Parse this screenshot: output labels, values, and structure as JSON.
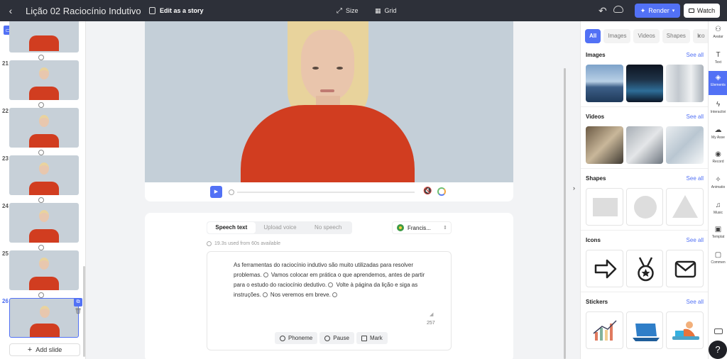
{
  "topbar": {
    "back": "‹",
    "title": "Lição 02 Raciocínio Indutivo",
    "edit_story": "Edit as a story",
    "size": "Size",
    "grid": "Grid",
    "render": "Render",
    "watch": "Watch"
  },
  "slides": {
    "items": [
      {
        "num": ""
      },
      {
        "num": "21"
      },
      {
        "num": "22"
      },
      {
        "num": "23"
      },
      {
        "num": "24"
      },
      {
        "num": "25"
      },
      {
        "num": "26"
      }
    ],
    "add_slide": "Add slide"
  },
  "script": {
    "tabs": [
      "Speech text",
      "Upload voice",
      "No speech"
    ],
    "voice": "Francis...",
    "usage": "19.3s used from 60s available",
    "text_parts": [
      "As ferramentas do raciocínio indutivo são muito utilizadas para resolver problemas.",
      "Vamos colocar em prática o que aprendemos, antes de partir para o estudo do raciocínio dedutivo.",
      "Volte à página da lição e siga as instruções.",
      "Nos veremos em breve."
    ],
    "char_count": "257",
    "actions": {
      "phoneme": "Phoneme",
      "pause": "Pause",
      "mark": "Mark"
    }
  },
  "panel": {
    "tabs": [
      "All",
      "Images",
      "Videos",
      "Shapes",
      "Ico"
    ],
    "sections": {
      "images": "Images",
      "videos": "Videos",
      "shapes": "Shapes",
      "icons": "Icons",
      "stickers": "Stickers"
    },
    "see_all": "See all"
  },
  "rail": {
    "items": [
      "Avatar",
      "Text",
      "Elements",
      "Interactivi",
      "My Asse",
      "Record",
      "Animatio",
      "Music",
      "Templat",
      "Commen"
    ]
  },
  "help": "?",
  "colors": {
    "accent": "#5271f5",
    "topbar": "#2d3039",
    "sweater": "#d13d20"
  }
}
